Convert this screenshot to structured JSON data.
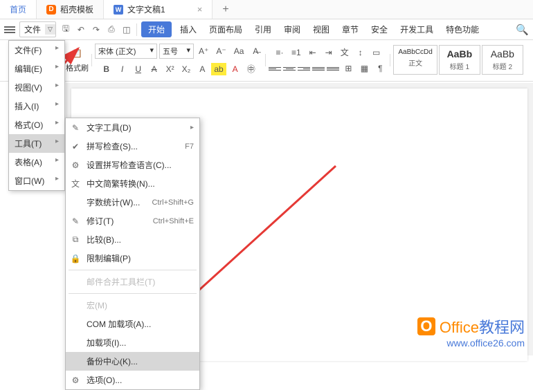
{
  "tabs": {
    "home": "首页",
    "docer": "稻壳模板",
    "doc": "文字文稿1"
  },
  "file_label": "文件",
  "menubar": [
    "开始",
    "插入",
    "页面布局",
    "引用",
    "审阅",
    "视图",
    "章节",
    "安全",
    "开发工具",
    "特色功能"
  ],
  "font_name": "宋体 (正文)",
  "font_size": "五号",
  "formatbrush": "格式刷",
  "styles": [
    {
      "preview": "AaBbCcDd",
      "label": "正文"
    },
    {
      "preview": "AaBb",
      "label": "标题 1"
    },
    {
      "preview": "AaBb",
      "label": "标题 2"
    }
  ],
  "file_menu": [
    {
      "label": "文件(F)",
      "sub": true
    },
    {
      "label": "编辑(E)",
      "sub": true
    },
    {
      "label": "视图(V)",
      "sub": true
    },
    {
      "label": "插入(I)",
      "sub": true
    },
    {
      "label": "格式(O)",
      "sub": true
    },
    {
      "label": "工具(T)",
      "sub": true,
      "hl": true
    },
    {
      "label": "表格(A)",
      "sub": true
    },
    {
      "label": "窗口(W)",
      "sub": true
    }
  ],
  "tools_menu": [
    {
      "icon": "✎",
      "label": "文字工具(D)",
      "sub": true
    },
    {
      "icon": "✔",
      "label": "拼写检查(S)...",
      "shortcut": "F7"
    },
    {
      "icon": "⚙",
      "label": "设置拼写检查语言(C)..."
    },
    {
      "icon": "文",
      "label": "中文简繁转换(N)..."
    },
    {
      "icon": "",
      "label": "字数统计(W)...",
      "shortcut": "Ctrl+Shift+G"
    },
    {
      "icon": "✎",
      "label": "修订(T)",
      "shortcut": "Ctrl+Shift+E"
    },
    {
      "icon": "⧉",
      "label": "比较(B)..."
    },
    {
      "icon": "🔒",
      "label": "限制编辑(P)"
    },
    {
      "sep": true
    },
    {
      "icon": "",
      "label": "邮件合并工具栏(T)",
      "disabled": true
    },
    {
      "sep": true
    },
    {
      "icon": "",
      "label": "宏(M)",
      "disabled": true
    },
    {
      "icon": "",
      "label": "COM 加载项(A)..."
    },
    {
      "icon": "",
      "label": "加载项(I)..."
    },
    {
      "icon": "",
      "label": "备份中心(K)...",
      "hl": true
    },
    {
      "icon": "⚙",
      "label": "选项(O)..."
    }
  ],
  "watermark": {
    "brand_a": "Office",
    "brand_b": "教程网",
    "url": "www.office26.com"
  }
}
